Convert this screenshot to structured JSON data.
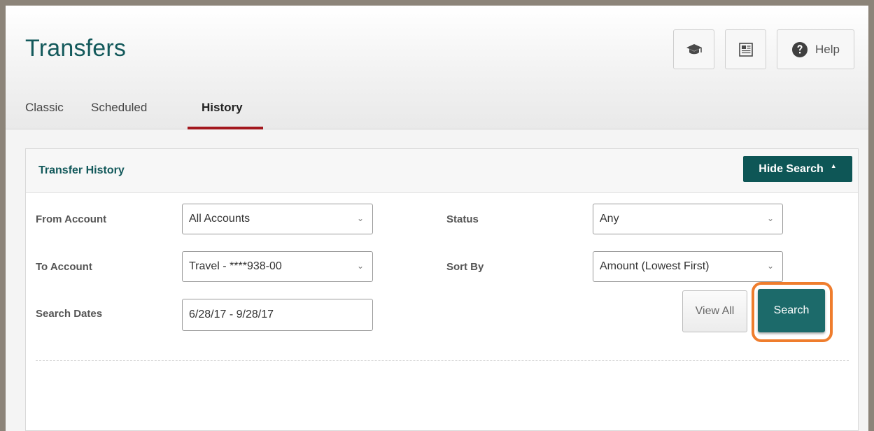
{
  "header": {
    "title": "Transfers",
    "help_label": "Help"
  },
  "icons": {
    "education": "graduation-cap-icon",
    "statement": "newspaper-icon",
    "help": "question-circle-icon"
  },
  "tabs": [
    {
      "label": "Classic",
      "active": false
    },
    {
      "label": "Scheduled",
      "active": false
    },
    {
      "label": "History",
      "active": true
    }
  ],
  "panel": {
    "title": "Transfer History",
    "toggle_label": "Hide Search"
  },
  "form": {
    "from_account": {
      "label": "From Account",
      "value": "All Accounts"
    },
    "to_account": {
      "label": "To Account",
      "value": "Travel - ****938-00"
    },
    "search_dates": {
      "label": "Search Dates",
      "value": "6/28/17 - 9/28/17"
    },
    "status": {
      "label": "Status",
      "value": "Any"
    },
    "sort_by": {
      "label": "Sort By",
      "value": "Amount (Lowest First)"
    }
  },
  "actions": {
    "view_all_label": "View All",
    "search_label": "Search"
  },
  "colors": {
    "brand": "#13595b",
    "primary_button": "#0e5656",
    "active_tab": "#a3181e",
    "highlight": "#ef7d2d"
  }
}
